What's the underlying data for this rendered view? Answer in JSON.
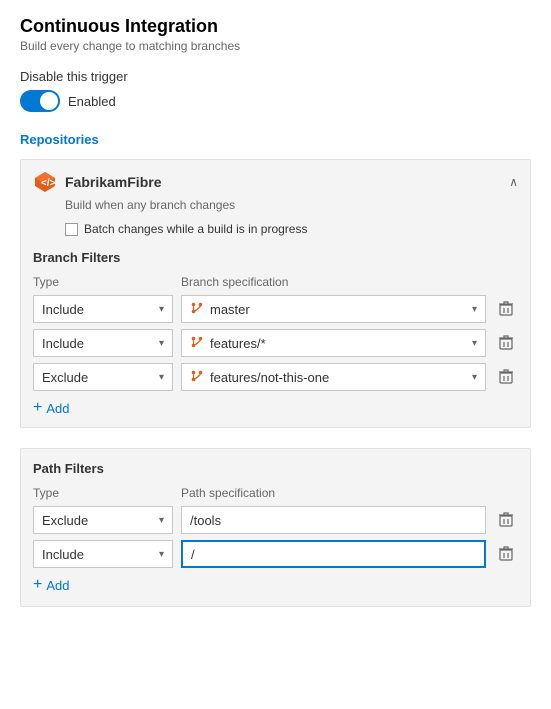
{
  "header": {
    "title": "Continuous Integration",
    "subtitle": "Build every change to matching branches"
  },
  "trigger": {
    "label": "Disable this trigger",
    "status": "Enabled",
    "enabled": true
  },
  "repositories": {
    "section_title": "Repositories",
    "repo": {
      "name": "FabrikamFibre",
      "description": "Build when any branch changes",
      "batch_label": "Batch changes while a build is in progress"
    }
  },
  "branch_filters": {
    "title": "Branch Filters",
    "type_header": "Type",
    "spec_header": "Branch specification",
    "rows": [
      {
        "type": "Include",
        "spec": "master"
      },
      {
        "type": "Include",
        "spec": "features/*"
      },
      {
        "type": "Exclude",
        "spec": "features/not-this-one"
      }
    ],
    "add_label": "Add"
  },
  "path_filters": {
    "title": "Path Filters",
    "type_header": "Type",
    "spec_header": "Path specification",
    "rows": [
      {
        "type": "Exclude",
        "spec": "/tools",
        "active": false
      },
      {
        "type": "Include",
        "spec": "/",
        "active": true
      }
    ],
    "add_label": "Add"
  },
  "icons": {
    "branch": "⑂",
    "delete": "🗑",
    "chevron_down": "▾",
    "chevron_up": "∧",
    "plus": "+"
  }
}
